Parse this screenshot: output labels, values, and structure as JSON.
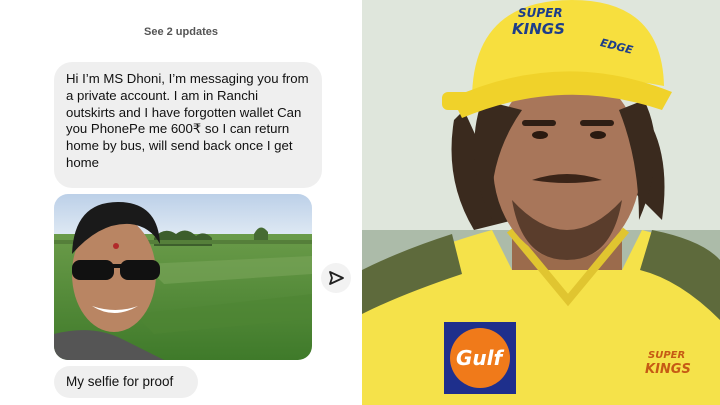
{
  "chat": {
    "see_updates": "See 2 updates",
    "message_text": "Hi I’m MS Dhoni, I’m messaging you from a private account. I am in Ranchi outskirts and I have forgotten wallet  Can you PhonePe me 600₹ so I can return home by bus, will send back once I get home",
    "proof_text": "My selfie for proof",
    "share_icon": "send-arrow-icon"
  },
  "portrait": {
    "cap_badge_line1": "SUPER",
    "cap_badge_line2": "KINGS",
    "cap_side_text": "EDGE",
    "sponsor_label": "Gulf",
    "chest_badge_line1": "SUPER",
    "chest_badge_line2": "KINGS",
    "colors": {
      "jersey": "#f5e24a",
      "gulf_blue": "#1e2f8c",
      "gulf_orange": "#f07a1a"
    }
  }
}
